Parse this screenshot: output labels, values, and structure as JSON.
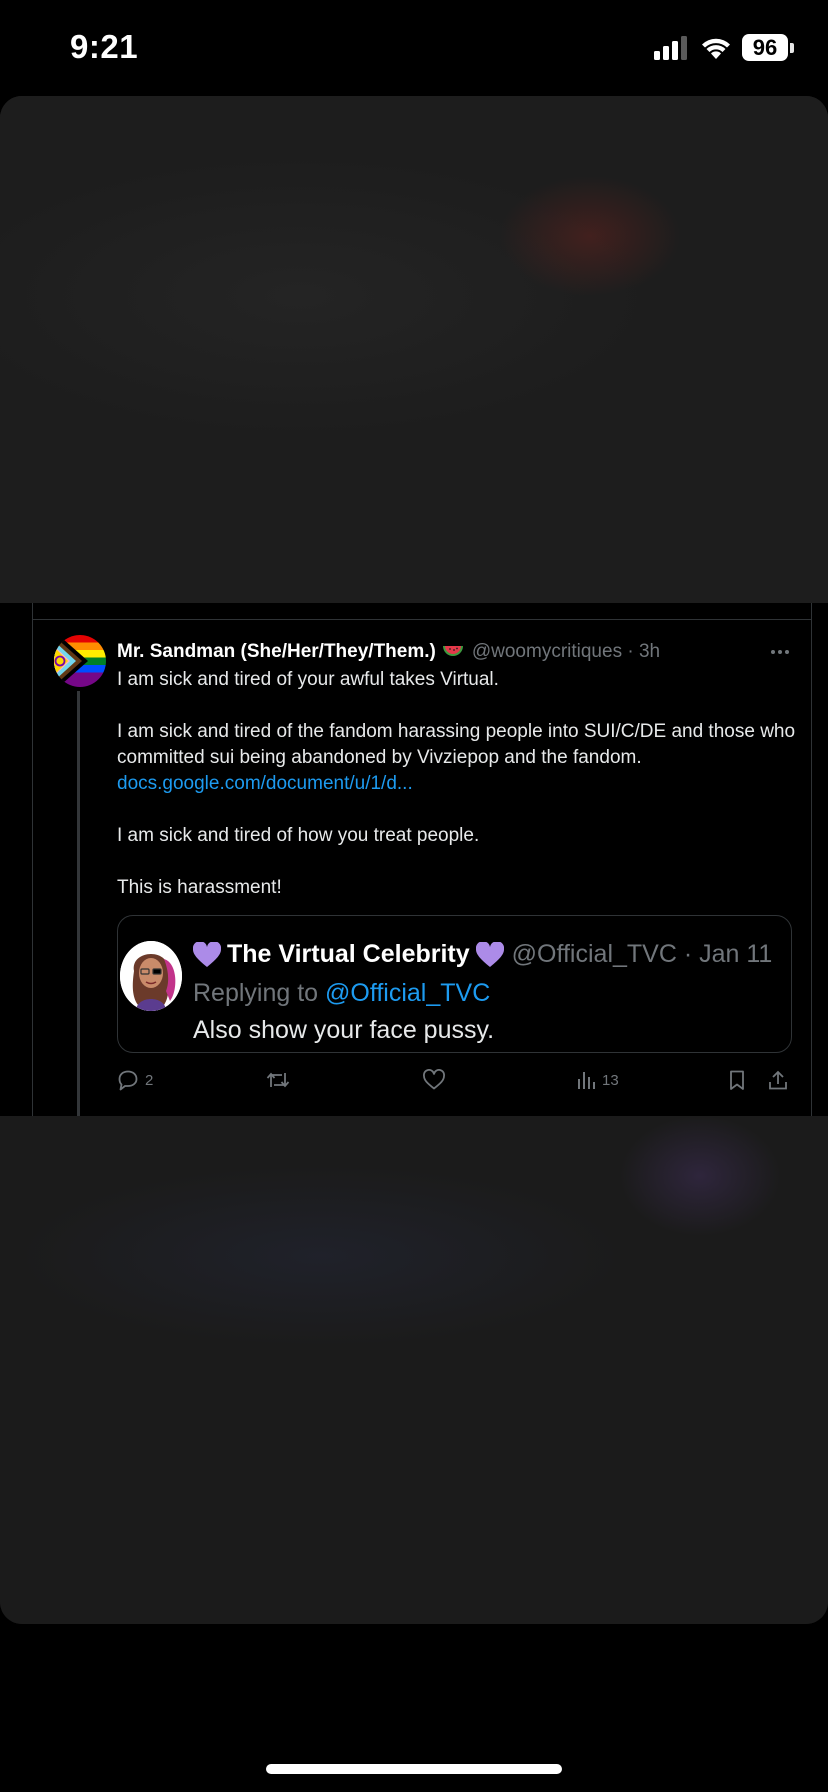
{
  "status_bar": {
    "time": "9:21",
    "battery": "96"
  },
  "tweet": {
    "author_name": "Mr. Sandman (She/Her/They/Them.)",
    "handle_time": "@woomycritiques · 3h",
    "lines": [
      "I am sick and tired of your awful takes Virtual.",
      "I am sick and tired of the fandom harassing people into SUI/C/DE and those who committed sui being abandoned by Vivziepop and the fandom.",
      "docs.google.com/document/u/1/d...",
      "I am sick and tired of how you treat people.",
      "This is harassment!"
    ],
    "quote": {
      "name": "The Virtual Celebrity",
      "handle_date": "@Official_TVC · Jan 11",
      "replying_label": "Replying to",
      "replying_handle": "@Official_TVC",
      "text": "Also show your face pussy."
    },
    "actions": {
      "replies": "2",
      "views": "13"
    }
  },
  "icons": {
    "more": "more-icon",
    "reply": "reply-icon",
    "retweet": "retweet-icon",
    "like": "like-icon",
    "views": "views-icon",
    "bookmark": "bookmark-icon",
    "share": "share-icon",
    "heart_emoji": "purple-heart-icon",
    "watermelon_emoji": "watermelon-icon"
  },
  "colors": {
    "link": "#1d9bf0",
    "muted": "#71767b",
    "border": "#2f3336",
    "heart": "#ac8be8"
  }
}
